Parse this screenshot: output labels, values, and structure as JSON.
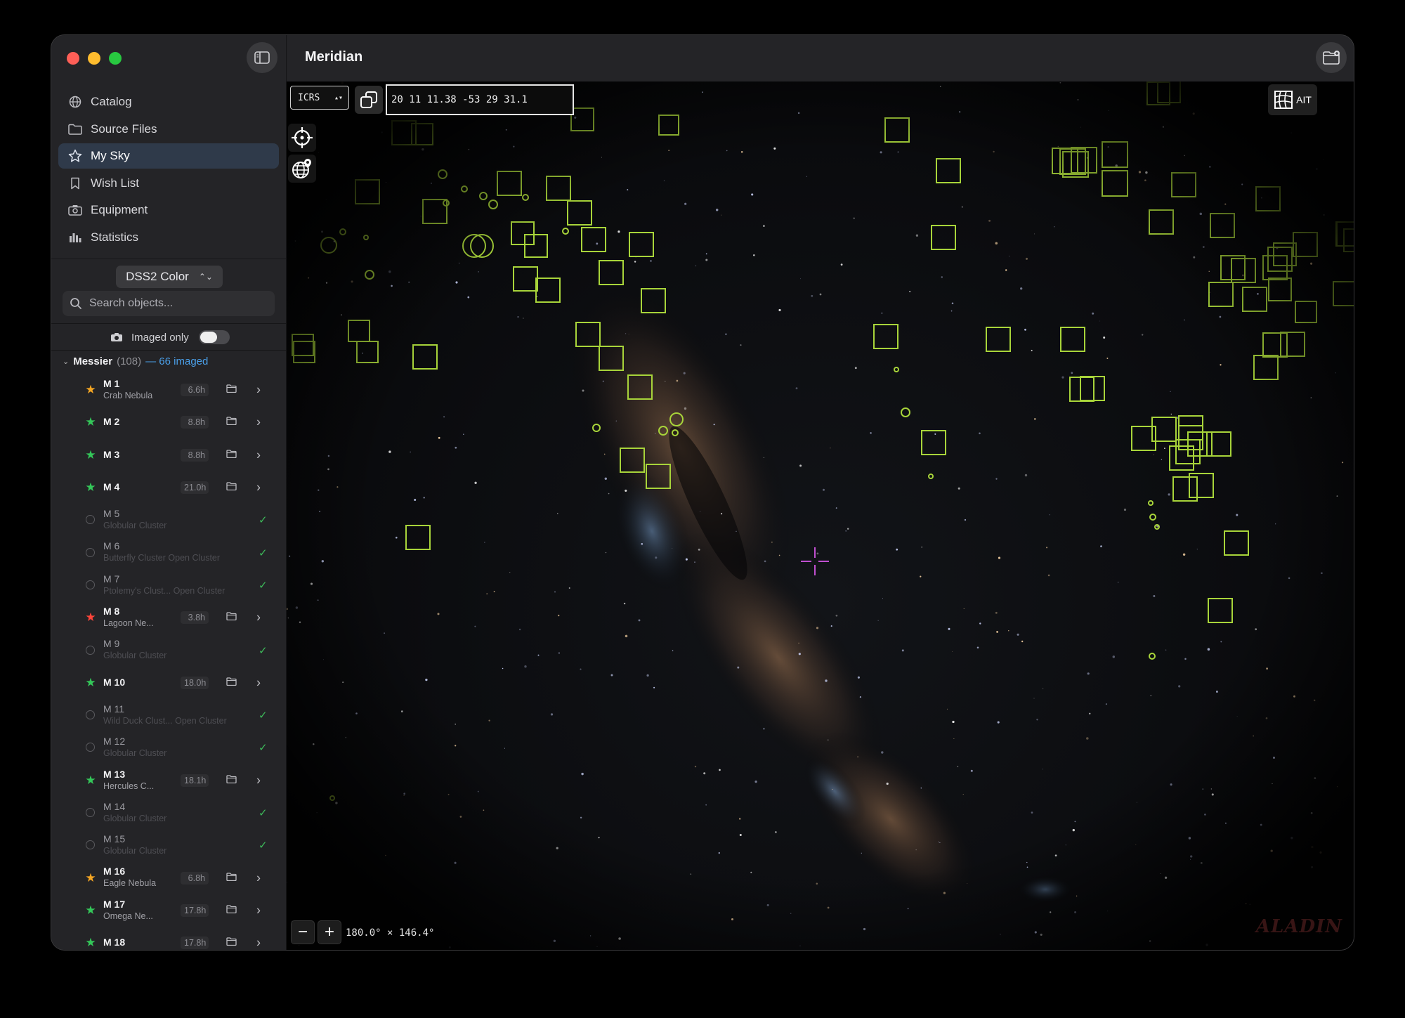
{
  "app_title": "Meridian",
  "sidebar": {
    "nav": [
      {
        "label": "Catalog",
        "icon": "globe-icon",
        "active": false
      },
      {
        "label": "Source Files",
        "icon": "folder-icon",
        "active": false
      },
      {
        "label": "My Sky",
        "icon": "star-icon",
        "active": true
      },
      {
        "label": "Wish List",
        "icon": "bookmark-icon",
        "active": false
      },
      {
        "label": "Equipment",
        "icon": "camera-icon",
        "active": false
      },
      {
        "label": "Statistics",
        "icon": "bar-chart-icon",
        "active": false
      }
    ],
    "survey": "DSS2 Color",
    "search_placeholder": "Search objects...",
    "imaged_only_label": "Imaged only",
    "imaged_only_enabled": false,
    "group": {
      "name": "Messier",
      "count": "(108)",
      "imaged": "— 66 imaged"
    },
    "objects": [
      {
        "name": "M 1",
        "sub": "Crab Nebula",
        "hours": "6.6h",
        "imaged": true,
        "star_color": "#f5a623"
      },
      {
        "name": "M 2",
        "sub": "",
        "hours": "8.8h",
        "imaged": true,
        "star_color": "#34c759"
      },
      {
        "name": "M 3",
        "sub": "",
        "hours": "8.8h",
        "imaged": true,
        "star_color": "#34c759"
      },
      {
        "name": "M 4",
        "sub": "",
        "hours": "21.0h",
        "imaged": true,
        "star_color": "#34c759"
      },
      {
        "name": "M 5",
        "sub": "Globular Cluster",
        "imaged": false
      },
      {
        "name": "M 6",
        "sub": "Butterfly Cluster  Open Cluster",
        "imaged": false
      },
      {
        "name": "M 7",
        "sub": "Ptolemy's Clust...  Open Cluster",
        "imaged": false
      },
      {
        "name": "M 8",
        "sub": "Lagoon Ne...",
        "hours": "3.8h",
        "imaged": true,
        "star_color": "#ff453a"
      },
      {
        "name": "M 9",
        "sub": "Globular Cluster",
        "imaged": false
      },
      {
        "name": "M 10",
        "sub": "",
        "hours": "18.0h",
        "imaged": true,
        "star_color": "#34c759"
      },
      {
        "name": "M 11",
        "sub": "Wild Duck Clust...  Open Cluster",
        "imaged": false
      },
      {
        "name": "M 12",
        "sub": "Globular Cluster",
        "imaged": false
      },
      {
        "name": "M 13",
        "sub": "Hercules C...",
        "hours": "18.1h",
        "imaged": true,
        "star_color": "#34c759"
      },
      {
        "name": "M 14",
        "sub": "Globular Cluster",
        "imaged": false
      },
      {
        "name": "M 15",
        "sub": "Globular Cluster",
        "imaged": false
      },
      {
        "name": "M 16",
        "sub": "Eagle Nebula",
        "hours": "6.8h",
        "imaged": true,
        "star_color": "#f5a623"
      },
      {
        "name": "M 17",
        "sub": "Omega Ne...",
        "hours": "17.8h",
        "imaged": true,
        "star_color": "#34c759"
      },
      {
        "name": "M 18",
        "sub": "",
        "hours": "17.8h",
        "imaged": true,
        "star_color": "#34c759"
      }
    ]
  },
  "sky_view": {
    "frame": "ICRS",
    "coordinates": "20 11 11.38 -53 29 31.1",
    "projection": "AIT",
    "fov": "180.0° × 146.4°",
    "watermark": "ALADIN",
    "overlay_color": "#a8d43a",
    "reticle_color": "#c04fd0"
  }
}
